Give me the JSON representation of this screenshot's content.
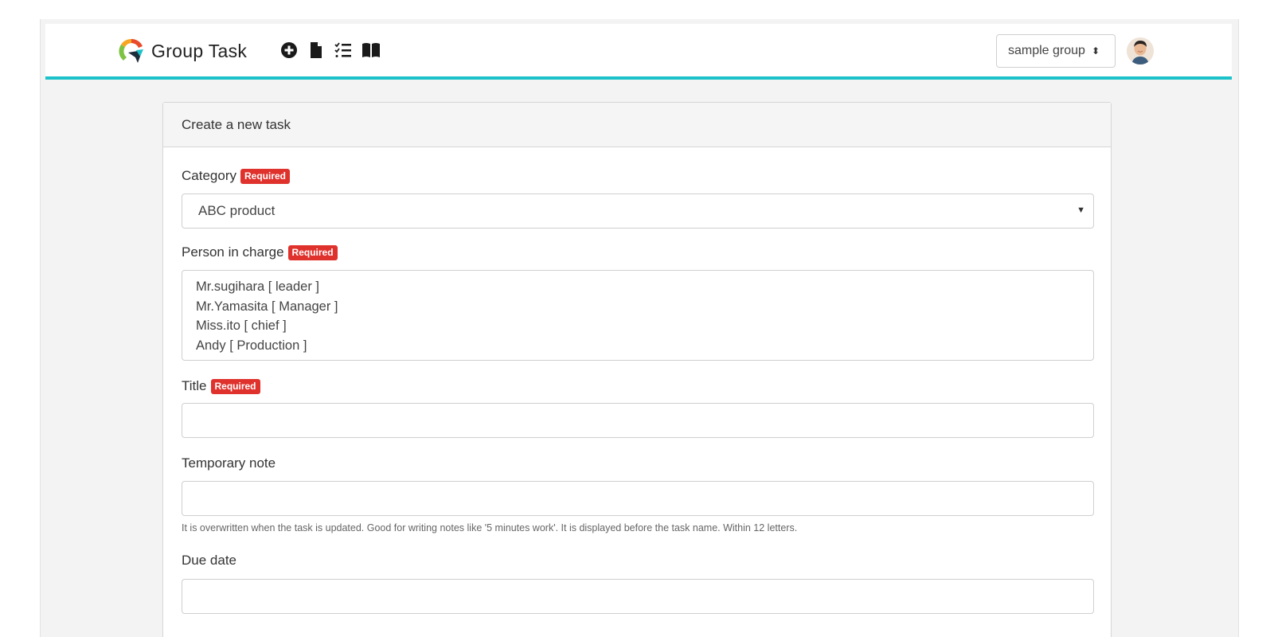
{
  "app": {
    "brand": "Group Task",
    "nav_icons": [
      "plus-circle-icon",
      "file-icon",
      "checklist-icon",
      "book-icon"
    ],
    "group_select": "sample group",
    "accent_color": "#1bc2c9"
  },
  "form": {
    "header": "Create a new task",
    "required_badge": "Required",
    "category": {
      "label": "Category",
      "value": "ABC product"
    },
    "person": {
      "label": "Person in charge",
      "options": [
        "Mr.sugihara [ leader ]",
        "Mr.Yamasita [ Manager ]",
        "Miss.ito [ chief ]",
        "Andy [ Production ]"
      ]
    },
    "title": {
      "label": "Title",
      "value": ""
    },
    "temp_note": {
      "label": "Temporary note",
      "value": "",
      "help": "It is overwritten when the task is updated. Good for writing notes like '5 minutes work'. It is displayed before the task name. Within 12 letters."
    },
    "due_date": {
      "label": "Due date",
      "value": ""
    }
  }
}
